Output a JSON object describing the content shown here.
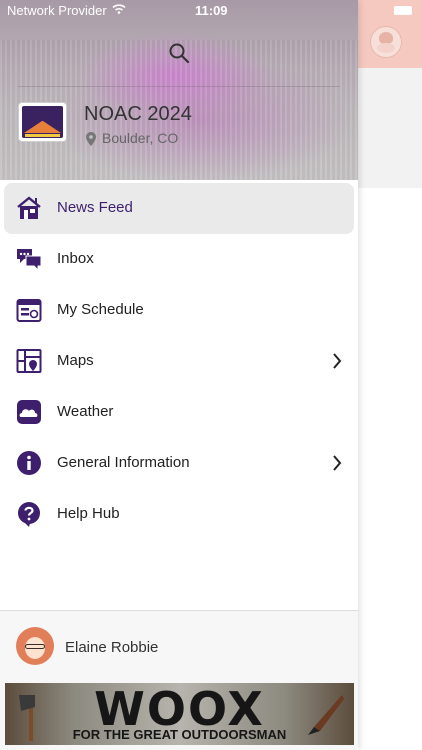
{
  "status_bar": {
    "carrier": "Network Provider",
    "time": "11:09"
  },
  "event": {
    "title": "NOAC 2024",
    "location": "Boulder, CO",
    "logo_text": "SEEK NEW HEIGHTS NOAC 2024"
  },
  "menu": {
    "items": [
      {
        "label": "News Feed",
        "icon": "house-news-icon",
        "active": true,
        "has_submenu": false
      },
      {
        "label": "Inbox",
        "icon": "chat-bubbles-icon",
        "active": false,
        "has_submenu": false
      },
      {
        "label": "My Schedule",
        "icon": "calendar-list-icon",
        "active": false,
        "has_submenu": false
      },
      {
        "label": "Maps",
        "icon": "map-icon",
        "active": false,
        "has_submenu": true
      },
      {
        "label": "Weather",
        "icon": "weather-icon",
        "active": false,
        "has_submenu": false
      },
      {
        "label": "General Information",
        "icon": "info-icon",
        "active": false,
        "has_submenu": true
      },
      {
        "label": "Help Hub",
        "icon": "help-icon",
        "active": false,
        "has_submenu": false
      }
    ]
  },
  "user": {
    "name": "Elaine Robbie"
  },
  "ad": {
    "brand": "WOOX",
    "tagline": "FOR THE GREAT OUTDOORSMAN"
  },
  "colors": {
    "accent": "#3d1f6e",
    "active_bg": "#eaeaea",
    "icon": "#3d1f6e"
  }
}
